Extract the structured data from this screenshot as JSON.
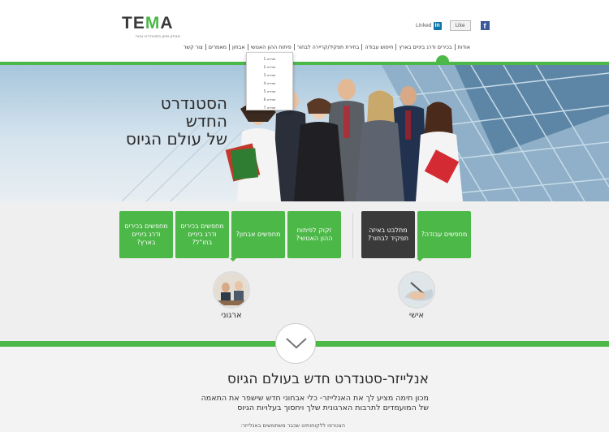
{
  "header": {
    "logo_prefix": "TE",
    "logo_accent": "M",
    "logo_suffix": "A",
    "logo_tagline": "אבחון ומיון בסטנדרט גבוה",
    "social": {
      "linkedin_text": "Linked",
      "linkedin_badge": "in",
      "like_label": "Like",
      "facebook_badge": "f"
    }
  },
  "nav": {
    "items": [
      "אודות",
      "בכירים ודרג ביניים בארץ",
      "חיפוש עבודה",
      "בחירת תפקיד/קריירה לבחור",
      "פיתוח ההון האנושי",
      "אבחון",
      "מאמרים",
      "צור קשר"
    ]
  },
  "dropdown": {
    "items": [
      "תפריט 1",
      "תפריט 2",
      "תפריט 3",
      "תפריט 4",
      "תפריט 5",
      "תפריט 6",
      "תפריט 7"
    ]
  },
  "hero": {
    "line1": "הסטנדרט",
    "line2": "החדש",
    "line3": "של עולם הגיוס"
  },
  "tiles": {
    "personal_job": "מחפשים עבודה?",
    "personal_career": "מתלבט באיזה תפקיד לבחור?",
    "org_hr": "זקוק לפיתוח ההון האנושי?",
    "org_assessment": "מחפשים אבחון?",
    "org_abroad": "מחפשים בכירים ודרג ביניים בחו\"ל?",
    "org_local": "מחפשים בכירים ודרג ביניים בארץ?"
  },
  "circles": {
    "personal_label": "אישי",
    "org_label": "ארגוני"
  },
  "content": {
    "heading": "אנלייזר-סטנדרט חדש בעולם הגיוס",
    "para_line1": "מכון תימה מציע לך את האנלייזר- כלי אבחוני חדש שישפר את התאמה",
    "para_line2": "של המועמדים לתרבות הארגונית שלך ויחסוך בעלויות הגיוס",
    "small_line": "הצטרפו ללקוחותינו שכבר משתמשים באנלייזר:"
  },
  "colors": {
    "brand_green": "#4cb848",
    "dark_tile": "#3a3a3a"
  }
}
